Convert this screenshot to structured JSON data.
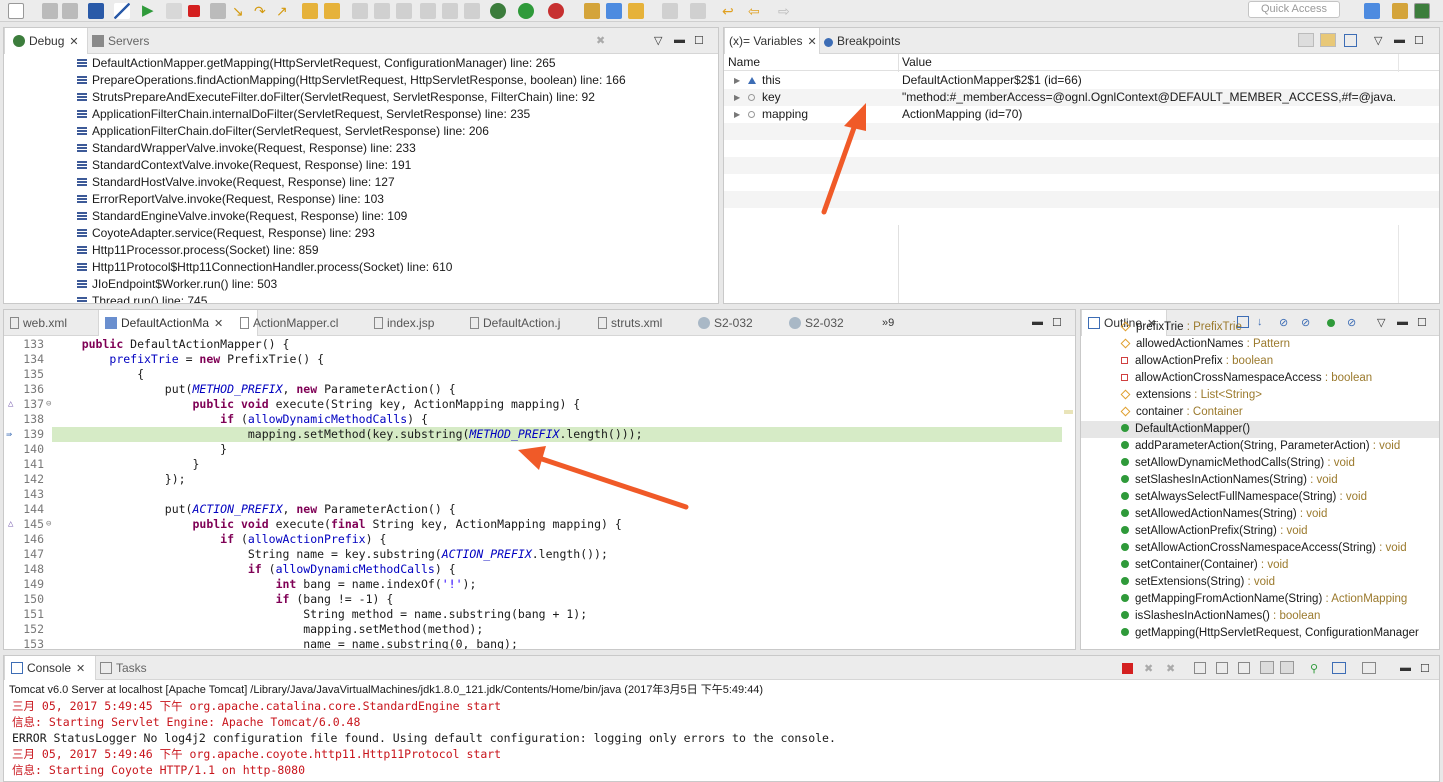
{
  "toolbar": {
    "quick_access_placeholder": "Quick Access"
  },
  "debug_view": {
    "tabs": [
      "Debug",
      "Servers"
    ],
    "frames": [
      "DefaultActionMapper.getMapping(HttpServletRequest, ConfigurationManager) line: 265",
      "PrepareOperations.findActionMapping(HttpServletRequest, HttpServletResponse, boolean) line: 166",
      "StrutsPrepareAndExecuteFilter.doFilter(ServletRequest, ServletResponse, FilterChain) line: 92",
      "ApplicationFilterChain.internalDoFilter(ServletRequest, ServletResponse) line: 235",
      "ApplicationFilterChain.doFilter(ServletRequest, ServletResponse) line: 206",
      "StandardWrapperValve.invoke(Request, Response) line: 233",
      "StandardContextValve.invoke(Request, Response) line: 191",
      "StandardHostValve.invoke(Request, Response) line: 127",
      "ErrorReportValve.invoke(Request, Response) line: 103",
      "StandardEngineValve.invoke(Request, Response) line: 109",
      "CoyoteAdapter.service(Request, Response) line: 293",
      "Http11Processor.process(Socket) line: 859",
      "Http11Protocol$Http11ConnectionHandler.process(Socket) line: 610",
      "JIoEndpoint$Worker.run() line: 503",
      "Thread.run() line: 745"
    ]
  },
  "variables_view": {
    "tabs": [
      "(x)= Variables",
      "Breakpoints"
    ],
    "columns": [
      "Name",
      "Value"
    ],
    "rows": [
      {
        "name": "this",
        "value": "DefaultActionMapper$2$1  (id=66)"
      },
      {
        "name": "key",
        "value": "\"method:#_memberAccess=@ognl.OgnlContext@DEFAULT_MEMBER_ACCESS,#f=@java.lang..."
      },
      {
        "name": "mapping",
        "value": "ActionMapping  (id=70)"
      }
    ]
  },
  "editor": {
    "tabs": [
      "web.xml",
      "DefaultActionMa",
      "ActionMapper.cl",
      "index.jsp",
      "DefaultAction.j",
      "struts.xml",
      "S2-032",
      "S2-032",
      "»9"
    ],
    "line_numbers": [
      "133",
      "134",
      "135",
      "136",
      "137",
      "138",
      "139",
      "140",
      "141",
      "142",
      "143",
      "144",
      "145",
      "146",
      "147",
      "148",
      "149",
      "150",
      "151",
      "152",
      "153"
    ]
  },
  "outline_view": {
    "title": "Outline",
    "items": [
      {
        "name": "prefixTrie",
        "type": " : PrefixTrie"
      },
      {
        "name": "allowedActionNames",
        "type": " : Pattern"
      },
      {
        "name": "allowActionPrefix",
        "type": " : boolean"
      },
      {
        "name": "allowActionCrossNamespaceAccess",
        "type": " : boolean"
      },
      {
        "name": "extensions",
        "type": " : List<String>"
      },
      {
        "name": "container",
        "type": " : Container"
      },
      {
        "name": "DefaultActionMapper()",
        "type": ""
      },
      {
        "name": "addParameterAction(String, ParameterAction)",
        "type": " : void"
      },
      {
        "name": "setAllowDynamicMethodCalls(String)",
        "type": " : void"
      },
      {
        "name": "setSlashesInActionNames(String)",
        "type": " : void"
      },
      {
        "name": "setAlwaysSelectFullNamespace(String)",
        "type": " : void"
      },
      {
        "name": "setAllowedActionNames(String)",
        "type": " : void"
      },
      {
        "name": "setAllowActionPrefix(String)",
        "type": " : void"
      },
      {
        "name": "setAllowActionCrossNamespaceAccess(String)",
        "type": " : void"
      },
      {
        "name": "setContainer(Container)",
        "type": " : void"
      },
      {
        "name": "setExtensions(String)",
        "type": " : void"
      },
      {
        "name": "getMappingFromActionName(String)",
        "type": " : ActionMapping"
      },
      {
        "name": "isSlashesInActionNames()",
        "type": " : boolean"
      },
      {
        "name": "getMapping(HttpServletRequest, ConfigurationManager",
        "type": ""
      }
    ]
  },
  "console_view": {
    "tabs": [
      "Console",
      "Tasks"
    ],
    "header": "Tomcat v6.0 Server at localhost [Apache Tomcat] /Library/Java/JavaVirtualMachines/jdk1.8.0_121.jdk/Contents/Home/bin/java (2017年3月5日 下午5:49:44)",
    "lines": [
      {
        "text": "三月 05, 2017 5:49:45 下午 org.apache.catalina.core.StandardEngine start",
        "err": true
      },
      {
        "text": "信息: Starting Servlet Engine: Apache Tomcat/6.0.48",
        "err": true
      },
      {
        "text": "ERROR StatusLogger No log4j2 configuration file found. Using default configuration: logging only errors to the console.",
        "err": false
      },
      {
        "text": "三月 05, 2017 5:49:46 下午 org.apache.coyote.http11.Http11Protocol start",
        "err": true
      },
      {
        "text": "信息: Starting Coyote HTTP/1.1 on http-8080",
        "err": true
      }
    ]
  },
  "colors": {
    "accent": "#3d6db5",
    "highlight_line": "#d6ebc6",
    "arrow": "#f05a28",
    "console_error": "#c8151c"
  }
}
